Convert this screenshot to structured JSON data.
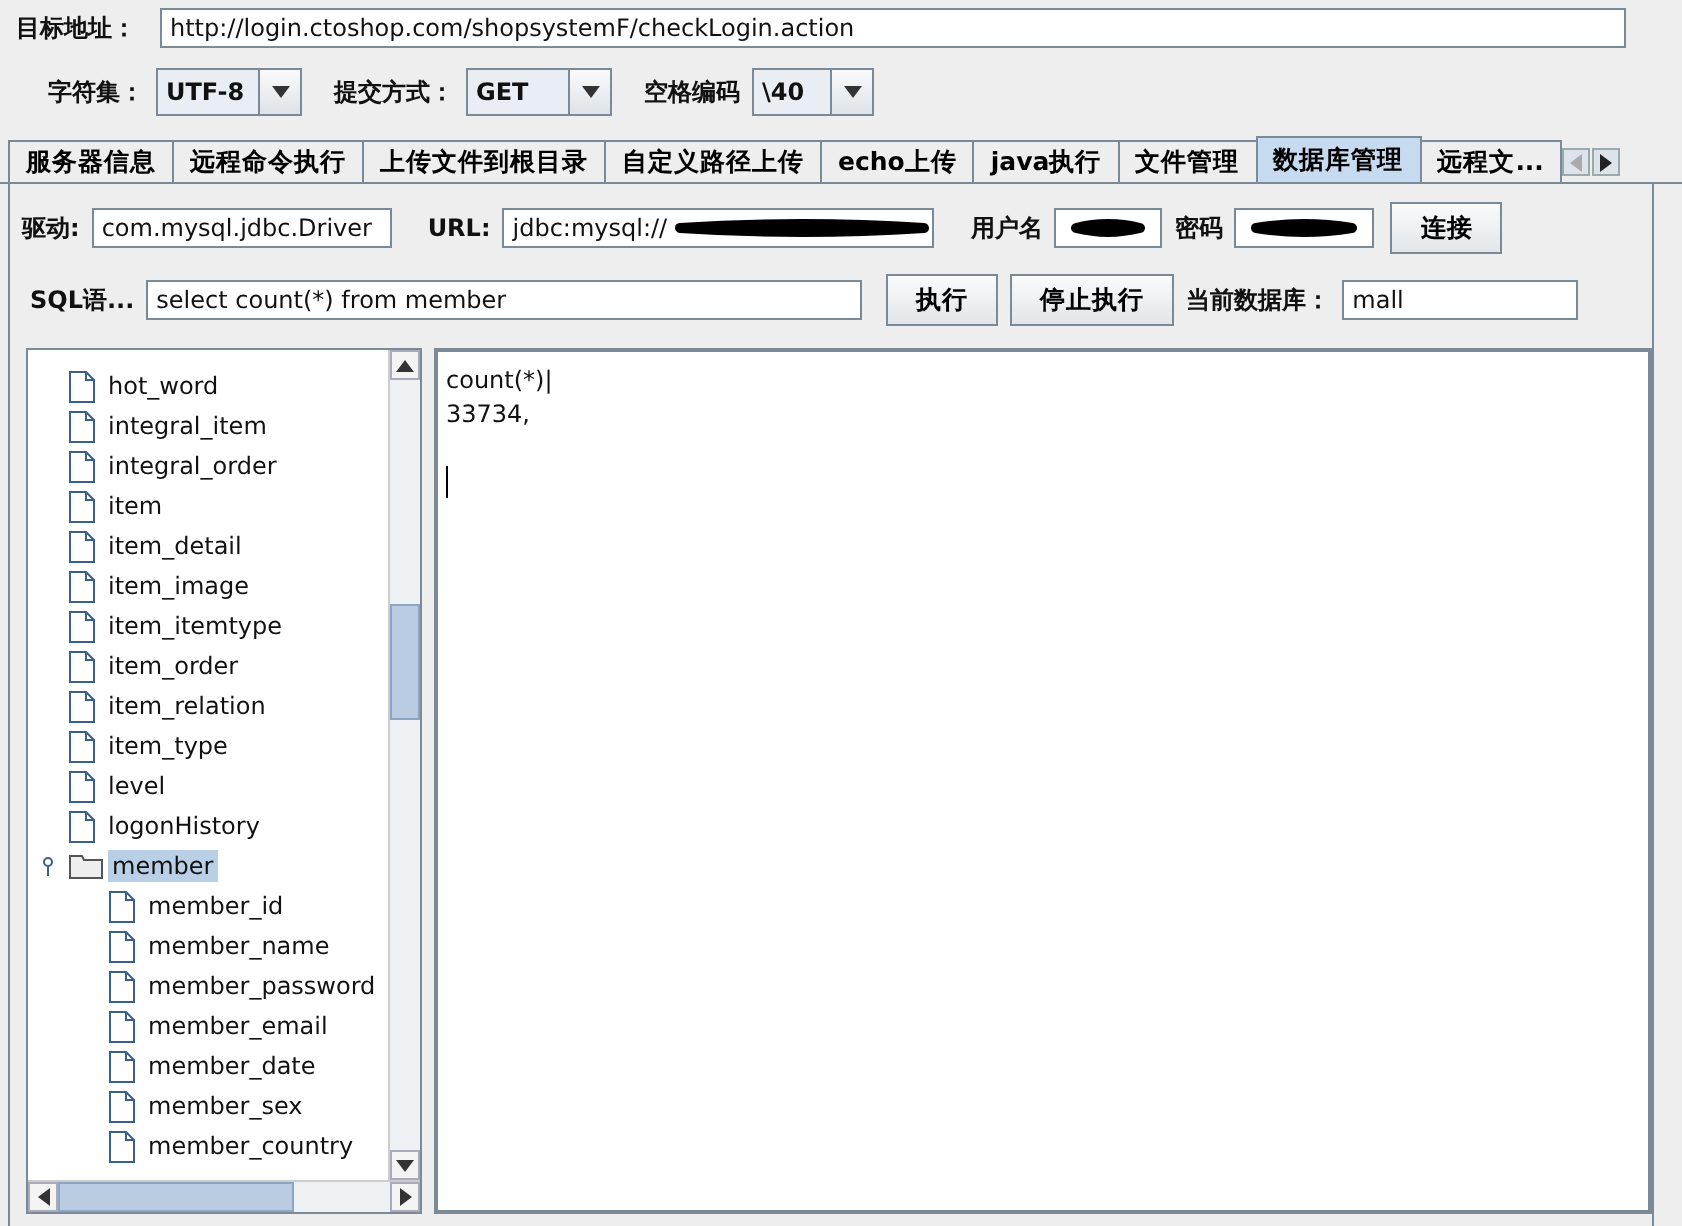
{
  "target": {
    "label": "目标地址：",
    "value": "http://login.ctoshop.com/shopsystemF/checkLogin.action"
  },
  "options": [
    {
      "label": "字符集：",
      "value": "UTF-8"
    },
    {
      "label": "提交方式：",
      "value": "GET"
    },
    {
      "label": "空格编码",
      "value": "\\40"
    }
  ],
  "tabs": [
    {
      "label": "服务器信息",
      "selected": false
    },
    {
      "label": "远程命令执行",
      "selected": false
    },
    {
      "label": "上传文件到根目录",
      "selected": false
    },
    {
      "label": "自定义路径上传",
      "selected": false
    },
    {
      "label": "echo上传",
      "selected": false
    },
    {
      "label": "java执行",
      "selected": false
    },
    {
      "label": "文件管理",
      "selected": false
    },
    {
      "label": "数据库管理",
      "selected": true
    },
    {
      "label": "远程文...",
      "selected": false
    }
  ],
  "connection": {
    "driver_label": "驱动:",
    "driver": "com.mysql.jdbc.Driver",
    "url_label": "URL:",
    "url": "jdbc:mysql://",
    "user_label": "用户名",
    "password_label": "密码",
    "connect_button": "连接"
  },
  "query": {
    "label": "SQL语...",
    "sql": "select count(*) from member",
    "run_button": "执行",
    "stop_button": "停止执行",
    "db_label": "当前数据库：",
    "db": "mall"
  },
  "tree": [
    {
      "label": "hot_word",
      "selected": false
    },
    {
      "label": "integral_item",
      "selected": false
    },
    {
      "label": "integral_order",
      "selected": false
    },
    {
      "label": "item",
      "selected": false
    },
    {
      "label": "item_detail",
      "selected": false
    },
    {
      "label": "item_image",
      "selected": false
    },
    {
      "label": "item_itemtype",
      "selected": false
    },
    {
      "label": "item_order",
      "selected": false
    },
    {
      "label": "item_relation",
      "selected": false
    },
    {
      "label": "item_type",
      "selected": false
    },
    {
      "label": "level",
      "selected": false
    },
    {
      "label": "logonHistory",
      "selected": false
    },
    {
      "label": "member",
      "selected": true,
      "expanded": true,
      "children": [
        {
          "label": "member_id",
          "selected": false
        },
        {
          "label": "member_name",
          "selected": false
        },
        {
          "label": "member_password",
          "selected": false
        },
        {
          "label": "member_email",
          "selected": false
        },
        {
          "label": "member_date",
          "selected": false
        },
        {
          "label": "member_sex",
          "selected": false
        },
        {
          "label": "member_country",
          "selected": false
        }
      ]
    }
  ],
  "result": [
    "count(*)|",
    "33734,"
  ]
}
